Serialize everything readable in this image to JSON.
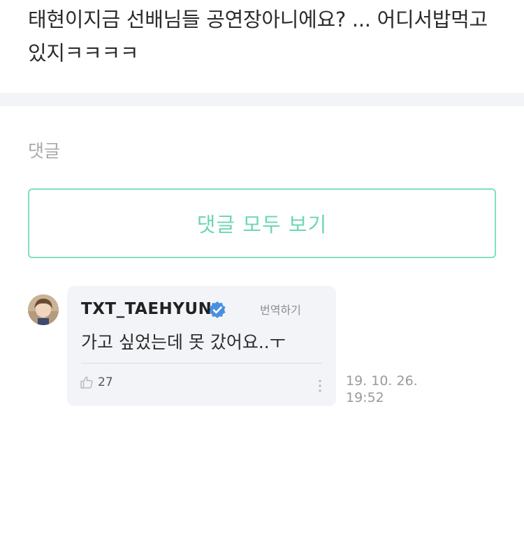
{
  "post": {
    "text": "태현이지금 선배님들 공연장아니에요? ... 어디서밥먹고있지ㅋㅋㅋㅋ"
  },
  "comments_section": {
    "label": "댓글",
    "view_all_label": "댓글 모두 보기"
  },
  "comment": {
    "author": "TXT_TAEHYUN",
    "verified_icon": "verified-check-badge",
    "translate_label": "번역하기",
    "body": "가고 싶었는데 못 갔어요..ㅜ",
    "like_count": "27",
    "timestamp_date": "19. 10. 26.",
    "timestamp_time": "19:52"
  },
  "colors": {
    "accent": "#6dd6b6",
    "bubble_bg": "#f3f4f8",
    "verified": "#4a90e2"
  }
}
